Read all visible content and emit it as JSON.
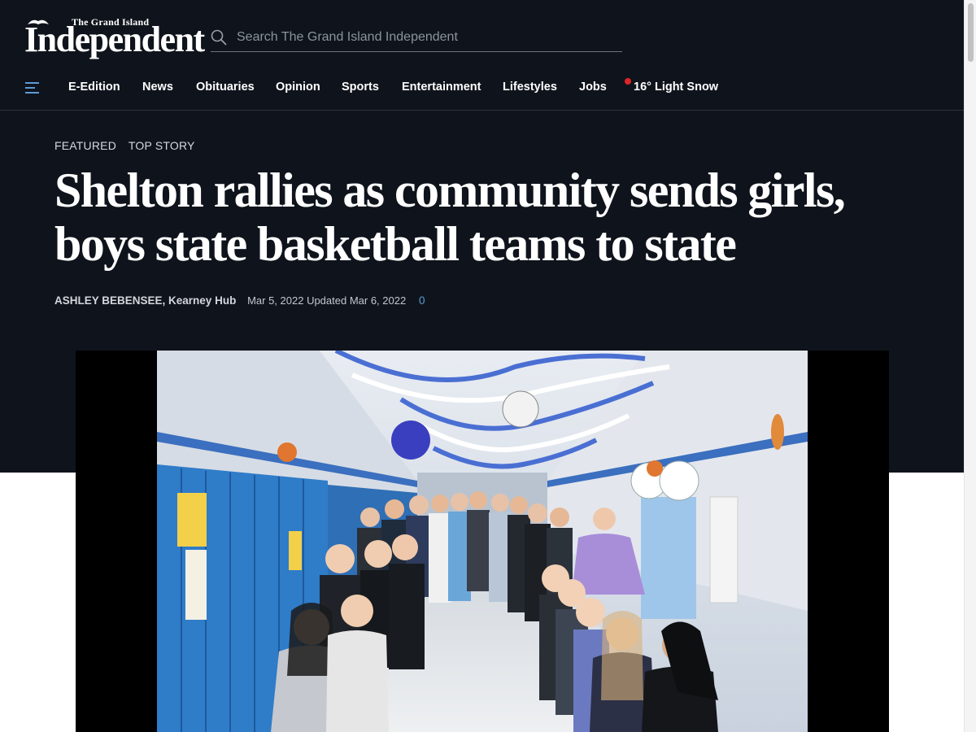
{
  "brand": {
    "logo_small": "The Grand Island",
    "logo_main": "Independent"
  },
  "search": {
    "placeholder": "Search The Grand Island Independent"
  },
  "nav": {
    "items": [
      "E-Edition",
      "News",
      "Obituaries",
      "Opinion",
      "Sports",
      "Entertainment",
      "Lifestyles",
      "Jobs"
    ],
    "weather": "16° Light Snow"
  },
  "article": {
    "tags": [
      "FEATURED",
      "TOP STORY"
    ],
    "headline": "Shelton rallies as community sends girls, boys state basketball teams to state",
    "author": "ASHLEY BEBENSEE, Kearney Hub",
    "dates": "Mar 5, 2022 Updated Mar 6, 2022",
    "comment_count": "0"
  },
  "colors": {
    "header_bg": "#0f141c",
    "accent_link": "#5b9bd5",
    "weather_dot": "#e0242a"
  }
}
